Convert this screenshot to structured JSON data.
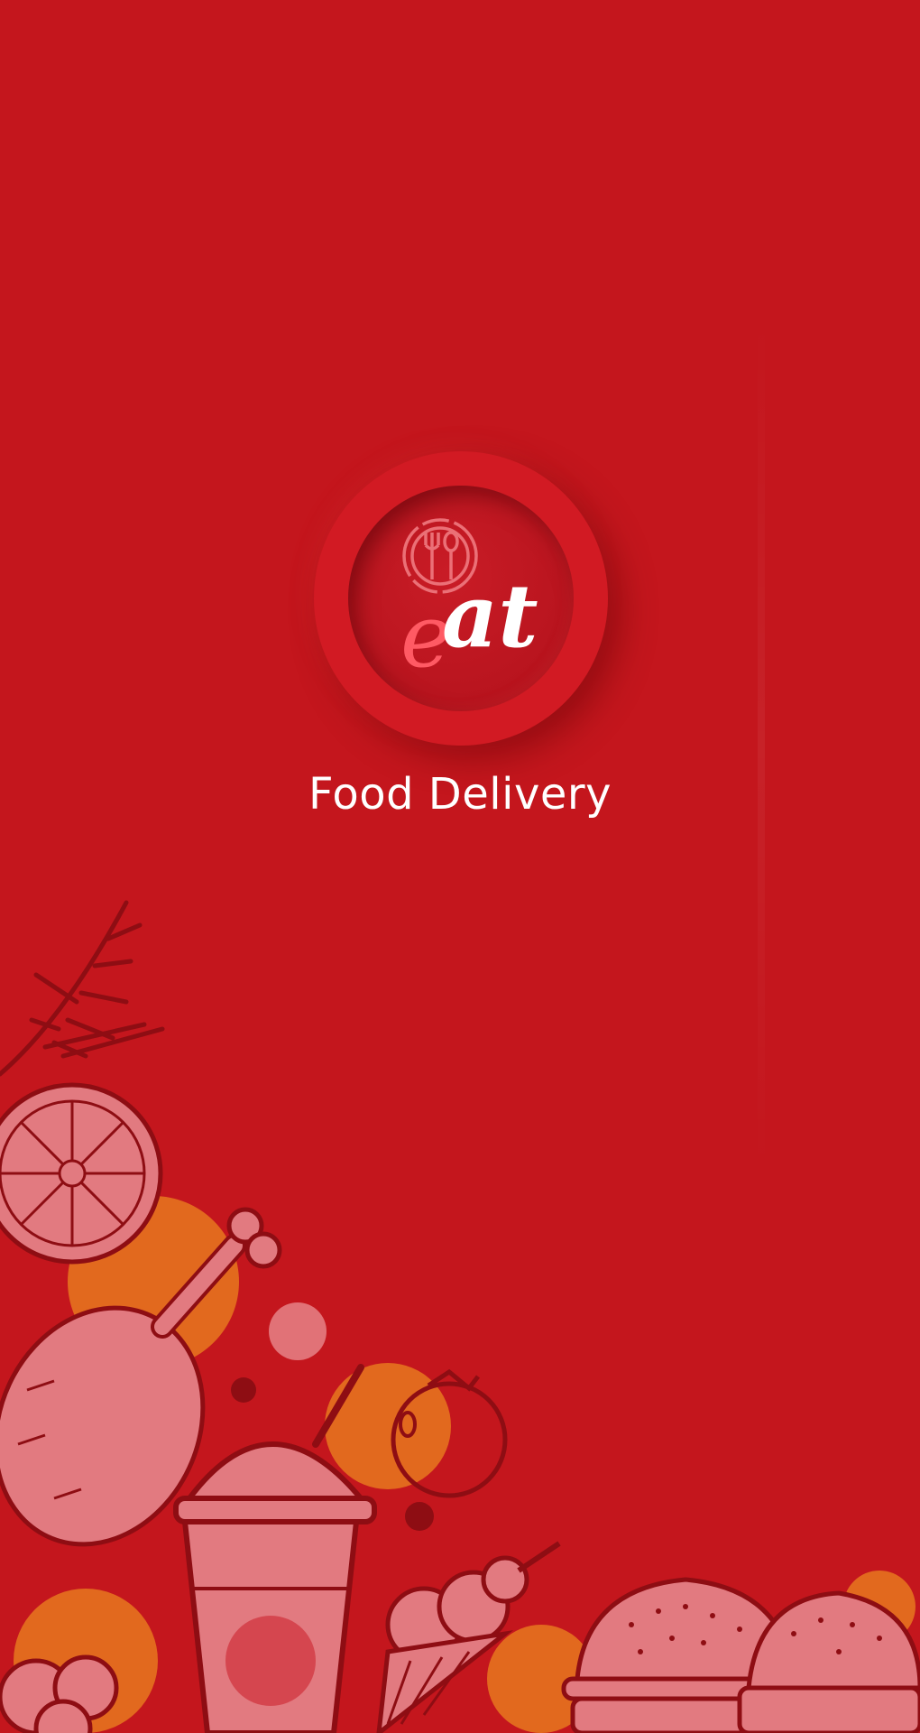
{
  "brand": {
    "logo_text": "eat",
    "tagline": "Food Delivery"
  },
  "colors": {
    "background": "#c4161d",
    "logo_ring": "#d21a23",
    "logo_core": "#b8141e",
    "text": "#ffffff",
    "accent_pink": "#ff5a64",
    "doodle_fill": "#e27a80",
    "doodle_stroke": "#8e0d13",
    "orange_splash": "#e8781e"
  },
  "icons": {
    "logo_emblem": "fork-spoon-plate-icon"
  },
  "illustration": {
    "items": [
      "branch",
      "orange-slice",
      "chicken-leg",
      "drink-cup",
      "tomato",
      "ice-cream-cone",
      "burger",
      "broccoli"
    ]
  }
}
